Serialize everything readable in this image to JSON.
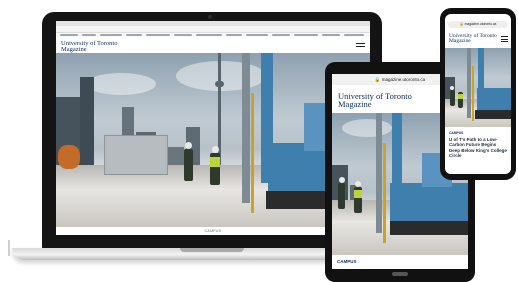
{
  "site": {
    "name_line1": "University of Toronto",
    "name_line2": "Magazine"
  },
  "laptop": {
    "caption": "CAMPUS"
  },
  "tablet": {
    "url": "magazine.utoronto.ca",
    "footer_label": "CAMPUS"
  },
  "phone": {
    "url": "magazine.utoronto.ca",
    "time": "",
    "article_kicker": "CAMPUS",
    "article_title": "U of T's Path to a Low-Carbon Future Begins Deep Below King's College Circle"
  },
  "colors": {
    "brand": "#0b2e5c",
    "device_frame": "#141414",
    "drill_blue": "#3f7fae",
    "vest_yellow": "#b9d43a"
  },
  "icons": [
    "menu-icon",
    "lock-icon",
    "camera-dot"
  ]
}
